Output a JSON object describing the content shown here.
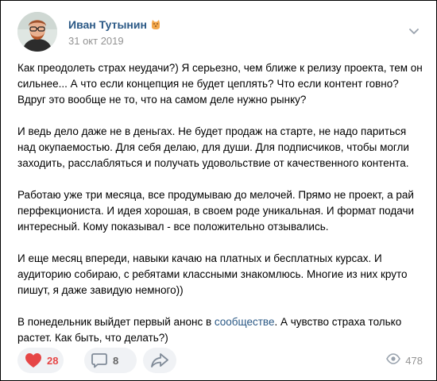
{
  "post": {
    "author": {
      "name": "Иван Тутынин",
      "badge_icon": "cat-emoji-icon"
    },
    "date": "31 окт 2019",
    "paragraphs": [
      "Как преодолеть страх неудачи?) Я серьезно, чем ближе к релизу проекта, тем он сильнее... А что если концепция не будет цеплять? Что если контент говно? Вдруг это вообще не то, что на самом деле нужно рынку?",
      "И ведь дело даже не в деньгах. Не будет продаж на старте, не надо париться над окупаемостью. Для себя делаю, для души. Для подписчиков, чтобы могли заходить, расслабляться и получать удовольствие от качественного контента.",
      "Работаю уже три месяца, все продумываю до мелочей. Прямо не проект, а рай перфекциониста. И идея хорошая, в своем роде уникальная. И формат подачи интересный. Кому показывал - все положительно отзывались.",
      "И еще месяц впереди, навыки качаю на платных и бесплатных курсах. И аудиторию собираю, с ребятами классными знакомлюсь. Многие из них круто пишут, я даже завидую немного))"
    ],
    "last_paragraph": {
      "before": "В понедельник выйдет первый анонс в ",
      "link": "сообществе",
      "after": ". А чувство страха только растет. Как быть, что делать?)"
    },
    "actions": {
      "likes": "28",
      "comments": "8",
      "views": "478"
    }
  },
  "colors": {
    "link": "#2a5885",
    "like": "#e64646",
    "muted": "#939393",
    "button_bg": "#f0f2f5"
  }
}
